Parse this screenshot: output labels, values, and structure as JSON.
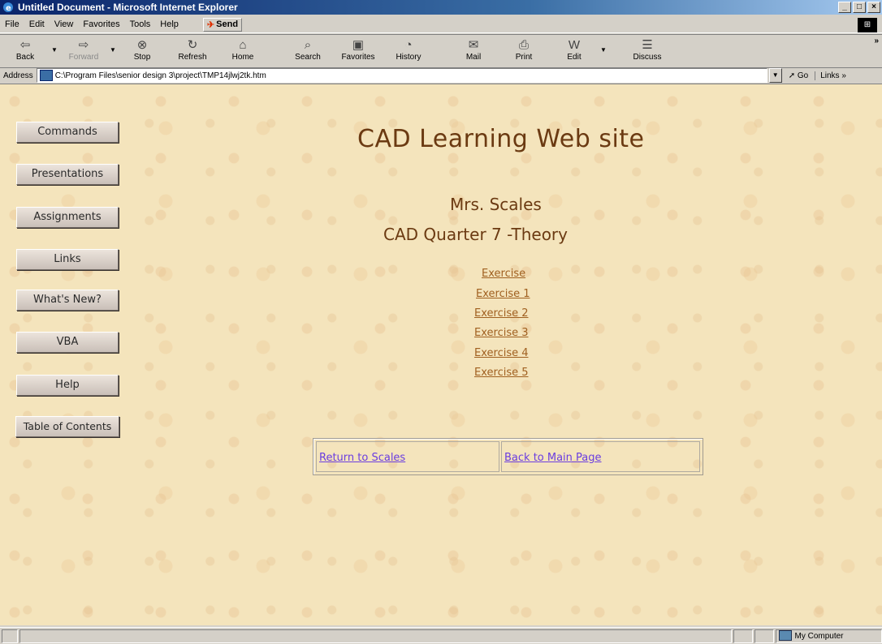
{
  "window": {
    "title": "Untitled Document - Microsoft Internet Explorer",
    "controls": [
      "_",
      "□",
      "×"
    ]
  },
  "menubar": {
    "items": [
      "File",
      "Edit",
      "View",
      "Favorites",
      "Tools",
      "Help"
    ],
    "send_label": "Send"
  },
  "toolbar": {
    "buttons": [
      {
        "label": "Back",
        "icon": "back-arrow-icon"
      },
      {
        "label": "Forward",
        "icon": "forward-arrow-icon"
      },
      {
        "label": "Stop",
        "icon": "stop-icon"
      },
      {
        "label": "Refresh",
        "icon": "refresh-icon"
      },
      {
        "label": "Home",
        "icon": "home-icon"
      },
      {
        "label": "Search",
        "icon": "search-icon"
      },
      {
        "label": "Favorites",
        "icon": "favorites-icon"
      },
      {
        "label": "History",
        "icon": "history-icon"
      },
      {
        "label": "Mail",
        "icon": "mail-icon"
      },
      {
        "label": "Print",
        "icon": "print-icon"
      },
      {
        "label": "Edit",
        "icon": "edit-icon"
      },
      {
        "label": "Discuss",
        "icon": "discuss-icon"
      }
    ]
  },
  "address": {
    "label": "Address",
    "url": "C:\\Program Files\\senior design 3\\project\\TMP14jlwj2tk.htm",
    "go_label": "Go",
    "links_label": "Links »"
  },
  "sidebar": {
    "buttons": [
      "Commands",
      "Presentations",
      "Assignments",
      "Links",
      "What's New?",
      "VBA",
      "Help",
      "Table of Contents"
    ]
  },
  "main": {
    "site_title": "CAD Learning Web site",
    "teacher": "Mrs. Scales",
    "quarter": "CAD Quarter 7 -Theory",
    "exercises": [
      "Exercise",
      "Exercise 1",
      "Exercise 2",
      "Exercise 3",
      "Exercise 4",
      "Exercise 5"
    ],
    "nav_links": {
      "return": "Return to Scales",
      "back": "Back to Main Page"
    }
  },
  "status": {
    "zone": "My Computer"
  },
  "colors": {
    "page_bg": "#f4e4bc",
    "title_text": "#6b3a12",
    "exercise_link": "#a06020",
    "nav_link": "#6a3de0"
  }
}
